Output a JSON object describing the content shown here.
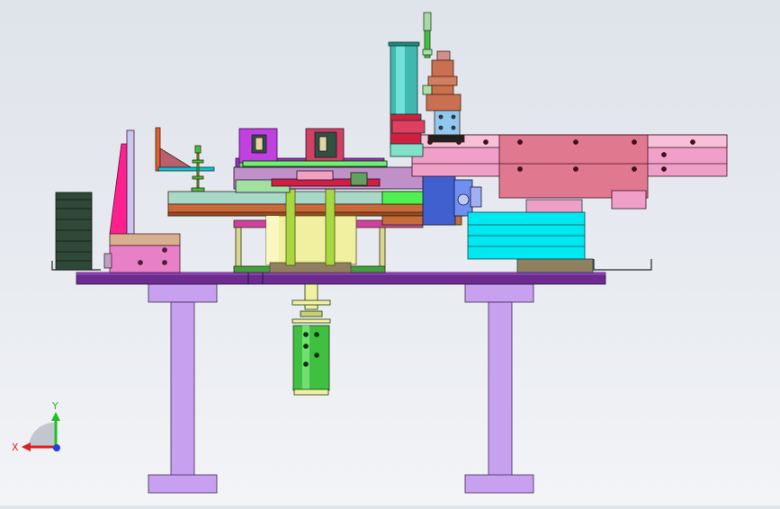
{
  "viewport": {
    "background_top": "#dfe3ea",
    "background_bottom": "#f3f4f7"
  },
  "colors": {
    "stand": "#c8a0f0",
    "base_plate": "#6b2b8f",
    "turntable": "#c86a3a",
    "slide_pink": "#f0a0c8",
    "slide_dark": "#e07890",
    "motor": "#00e8f0",
    "cylinder_yellow": "#f0f0a0",
    "lower_cylinder": "#40c040",
    "magenta_post": "#ff2090",
    "purple_clamp": "#c040e0",
    "green_bar": "#50f050",
    "fan_dark": "#304838",
    "axis_x": "#e02020",
    "axis_y": "#20c020",
    "axis_z": "#2040e0"
  },
  "triad": {
    "x_label": "X",
    "y_label": "Y"
  },
  "icons": [
    "coordinate-triad-icon"
  ]
}
